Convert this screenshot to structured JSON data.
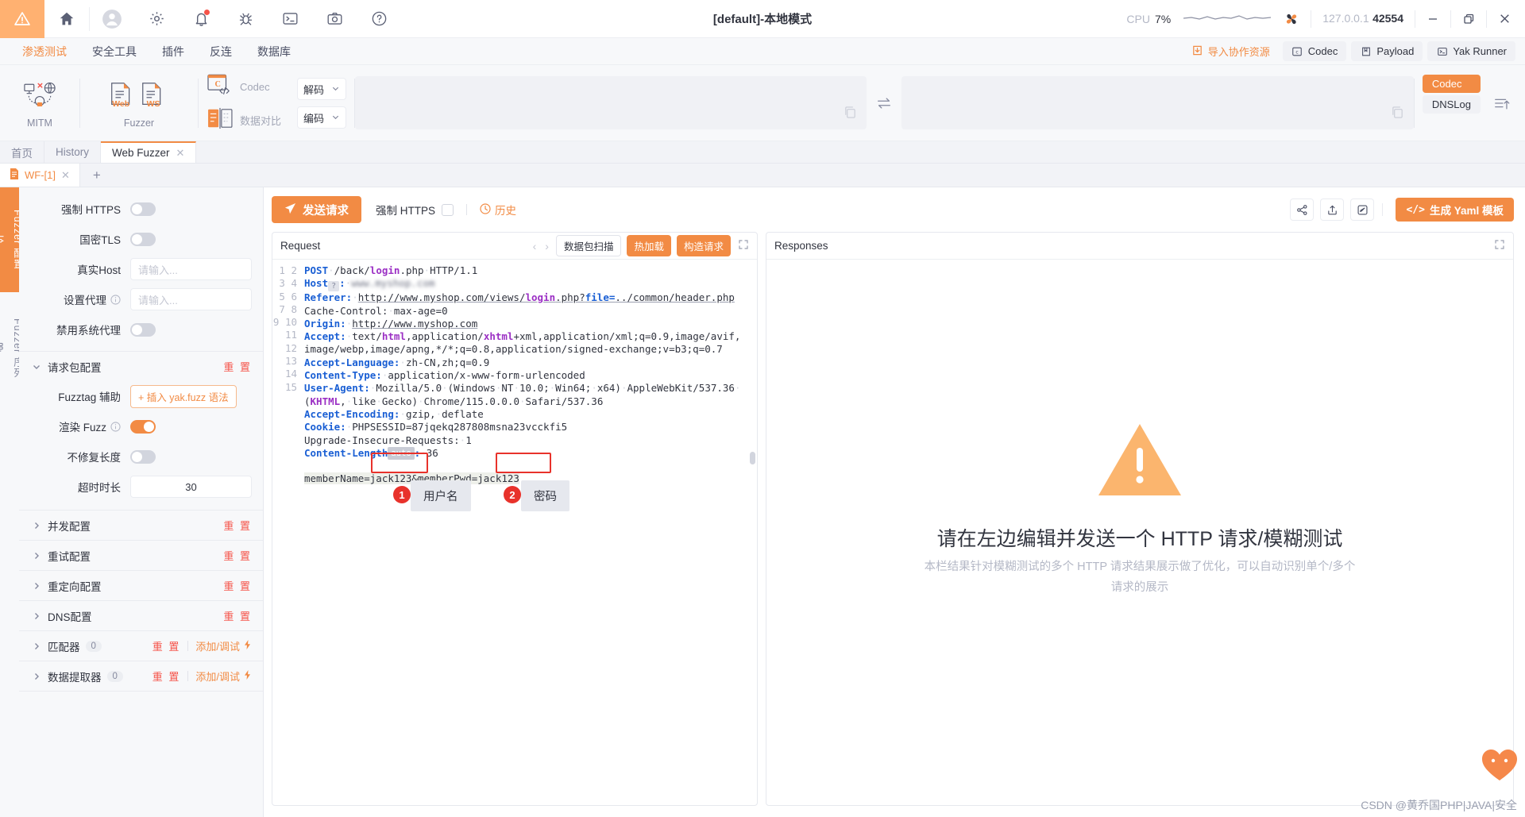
{
  "titlebar": {
    "title": "[default]-本地模式",
    "cpu_label": "CPU",
    "cpu_value": "7%",
    "addr_ip": "127.0.0.1",
    "addr_port": "42554",
    "icons": [
      "warning-triangle-icon",
      "home-icon",
      "user-avatar-icon",
      "gear-icon",
      "bell-icon",
      "bug-icon",
      "terminal-icon",
      "camera-icon",
      "help-icon"
    ],
    "window_controls": [
      "minimize",
      "maximize",
      "close"
    ]
  },
  "menubar": {
    "items": [
      {
        "label": "渗透测试",
        "active": true
      },
      {
        "label": "安全工具",
        "active": false
      },
      {
        "label": "插件",
        "active": false
      },
      {
        "label": "反连",
        "active": false
      },
      {
        "label": "数据库",
        "active": false
      }
    ],
    "import_label": "导入协作资源",
    "right_buttons": [
      {
        "label": "Codec",
        "icon": "codec-icon"
      },
      {
        "label": "Payload",
        "icon": "book-icon"
      },
      {
        "label": "Yak Runner",
        "icon": "terminal-icon"
      }
    ]
  },
  "ribbon": {
    "tools": [
      {
        "label": "MITM",
        "icon": "mitm-icon"
      },
      {
        "label": "Fuzzer",
        "icon": "fuzzer-icon"
      }
    ],
    "actions": [
      {
        "label": "Codec",
        "icon": "codec-window-icon"
      },
      {
        "label": "数据对比",
        "icon": "diff-icon"
      }
    ],
    "selects": [
      {
        "value": "解码"
      },
      {
        "value": "编码"
      }
    ],
    "tags": [
      {
        "label": "Codec",
        "active": true
      },
      {
        "label": "DNSLog",
        "active": false
      }
    ]
  },
  "page_tabs": [
    {
      "label": "首页",
      "active": false,
      "closable": false
    },
    {
      "label": "History",
      "active": false,
      "closable": false
    },
    {
      "label": "Web Fuzzer",
      "active": true,
      "closable": true
    }
  ],
  "sub_tabs": {
    "items": [
      {
        "label": "WF-[1]",
        "icon": "file-icon",
        "closable": true
      }
    ],
    "add_label": "+"
  },
  "rail": {
    "items": [
      {
        "label": "Fuzzer 配置",
        "icon": "sliders-icon",
        "active": true
      },
      {
        "label": "Fuzzer 序列",
        "icon": "stack-icon",
        "active": false
      }
    ]
  },
  "sidebar": {
    "rows": [
      {
        "label": "强制 HTTPS",
        "type": "switch",
        "on": false
      },
      {
        "label": "国密TLS",
        "type": "switch",
        "on": false
      },
      {
        "label": "真实Host",
        "type": "input",
        "value": "",
        "placeholder": "请输入..."
      },
      {
        "label": "设置代理",
        "type": "input",
        "value": "",
        "placeholder": "请输入...",
        "info": true
      },
      {
        "label": "禁用系统代理",
        "type": "switch",
        "on": false
      }
    ],
    "request_section": {
      "title": "请求包配置",
      "reset_label": "重 置",
      "fuzztag_label": "Fuzztag 辅助",
      "fuzztag_button": "+ 插入 yak.fuzz 语法",
      "render_fuzz_label": "渲染 Fuzz",
      "render_fuzz_on": true,
      "no_fix_len_label": "不修复长度",
      "no_fix_len_on": false,
      "timeout_label": "超时时长",
      "timeout_value": "30"
    },
    "sections": [
      {
        "title": "并发配置",
        "reset": "重 置",
        "count": null,
        "add": null
      },
      {
        "title": "重试配置",
        "reset": "重 置",
        "count": null,
        "add": null
      },
      {
        "title": "重定向配置",
        "reset": "重 置",
        "count": null,
        "add": null
      },
      {
        "title": "DNS配置",
        "reset": "重 置",
        "count": null,
        "add": null
      },
      {
        "title": "匹配器",
        "reset": "重 置",
        "count": "0",
        "add": "添加/调试"
      },
      {
        "title": "数据提取器",
        "reset": "重 置",
        "count": "0",
        "add": "添加/调试"
      }
    ]
  },
  "main_toolbar": {
    "send_label": "发送请求",
    "https_label": "强制 HTTPS",
    "https_checked": false,
    "history_label": "历史",
    "icons": [
      "share-icon",
      "export-icon",
      "edit-icon"
    ],
    "yaml_label": "生成 Yaml 模板"
  },
  "request_pane": {
    "title": "Request",
    "buttons": [
      {
        "label": "数据包扫描",
        "style": "outline"
      },
      {
        "label": "热加载",
        "style": "orange"
      },
      {
        "label": "构造请求",
        "style": "orange"
      }
    ],
    "lines": [
      {
        "n": "1",
        "text": "POST /back/login.php HTTP/1.1"
      },
      {
        "n": "2",
        "text": "Host: www.myshop.com"
      },
      {
        "n": "3",
        "text": "Referer: http://www.myshop.com/views/login.php?file=../common/header.php"
      },
      {
        "n": "4",
        "text": "Cache-Control: max-age=0"
      },
      {
        "n": "5",
        "text": "Origin: http://www.myshop.com"
      },
      {
        "n": "6",
        "text": "Accept: text/html,application/xhtml+xml,application/xml;q=0.9,image/avif,image/webp,image/apng,*/*;q=0.8,application/signed-exchange;v=b3;q=0.7"
      },
      {
        "n": "7",
        "text": "Accept-Language: zh-CN,zh;q=0.9"
      },
      {
        "n": "8",
        "text": "Content-Type: application/x-www-form-urlencoded"
      },
      {
        "n": "9",
        "text": "User-Agent: Mozilla/5.0 (Windows NT 10.0; Win64; x64) AppleWebKit/537.36 (KHTML, like Gecko) Chrome/115.0.0.0 Safari/537.36"
      },
      {
        "n": "10",
        "text": "Accept-Encoding: gzip, deflate"
      },
      {
        "n": "11",
        "text": "Cookie: PHPSESSID=87jqekq287808msna23vcckfi5"
      },
      {
        "n": "12",
        "text": "Upgrade-Insecure-Requests: 1"
      },
      {
        "n": "13",
        "text": "Content-Length auto: 36"
      },
      {
        "n": "14",
        "text": ""
      },
      {
        "n": "15",
        "text": "memberName=jack123&memberPwd=jack123"
      }
    ]
  },
  "annotations": [
    {
      "badge": "1",
      "label": "用户名"
    },
    {
      "badge": "2",
      "label": "密码"
    }
  ],
  "response_pane": {
    "title": "Responses",
    "empty_title": "请在左边编辑并发送一个 HTTP 请求/模糊测试",
    "empty_sub_line1": "本栏结果针对模糊测试的多个 HTTP 请求结果展示做了优化，可以自动识别单个/多个",
    "empty_sub_line2": "请求的展示",
    "warning_icon": "warning-triangle-icon"
  },
  "watermark": "CSDN @黄乔国PHP|JAVA|安全",
  "colors": {
    "accent": "#f28b44",
    "danger": "#f6544a",
    "annotation": "#e8322b",
    "text": "#31343f",
    "muted": "#85899e",
    "panel": "#f7f8fa"
  }
}
